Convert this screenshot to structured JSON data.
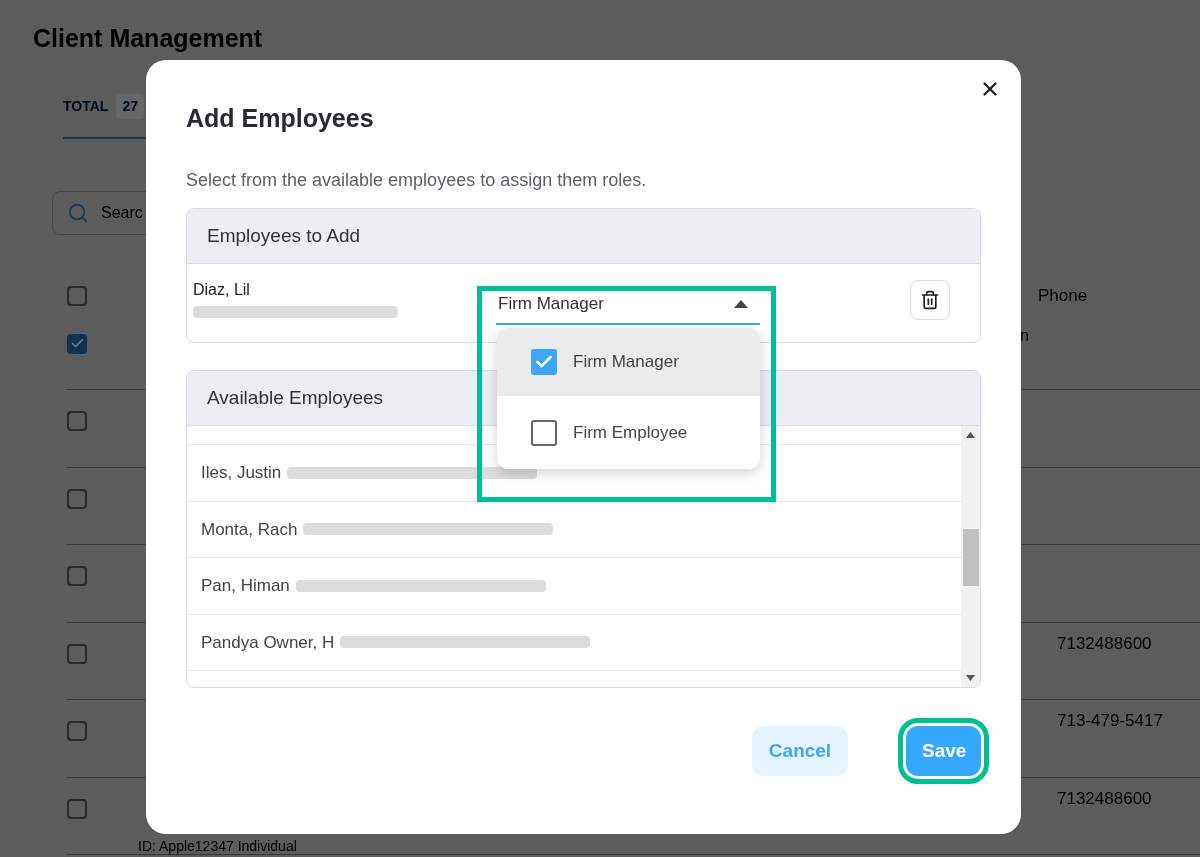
{
  "page": {
    "title": "Client Management",
    "tabs": [
      {
        "label": "TOTAL",
        "count": "27",
        "selected": true
      }
    ],
    "search": {
      "placeholder": "Searc"
    },
    "table": {
      "header_checked": false,
      "columns": [
        "Phone"
      ],
      "rows": [
        {
          "checked": true,
          "column_3": "n",
          "phone": ""
        },
        {
          "checked": false,
          "phone": ""
        },
        {
          "checked": false,
          "phone": ""
        },
        {
          "checked": false,
          "phone": ""
        },
        {
          "checked": false,
          "phone": "7132488600"
        },
        {
          "checked": false,
          "phone": "713-479-5417"
        },
        {
          "checked": false,
          "id": "ID: Apple12347 Individual",
          "phone": "7132488600"
        }
      ]
    }
  },
  "dialog": {
    "title": "Add Employees",
    "subtitle": "Select from the available employees to assign them roles.",
    "selected_panel": {
      "header": "Employees to Add",
      "employees": [
        {
          "name": "Diaz, Lil",
          "email_redacted": true,
          "role": "Firm Manager",
          "open": true
        }
      ]
    },
    "role_options": [
      {
        "label": "Firm Manager",
        "checked": true
      },
      {
        "label": "Firm Employee",
        "checked": false
      }
    ],
    "available_panel": {
      "header": "Available Employees",
      "employees": [
        {
          "name": "Iles, Justin",
          "email_redacted": true
        },
        {
          "name": "Monta, Rach",
          "email_redacted": true
        },
        {
          "name": "Pan, Himan",
          "email_redacted": true
        },
        {
          "name": "Pandya Owner, H",
          "email_redacted": true
        }
      ]
    },
    "buttons": [
      {
        "label": "Cancel",
        "kind": "secondary",
        "highlighted": false
      },
      {
        "label": "Save",
        "kind": "primary",
        "highlighted": true
      }
    ]
  }
}
